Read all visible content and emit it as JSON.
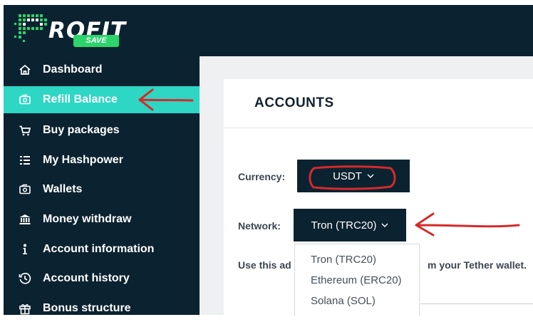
{
  "brand": {
    "logo_text": "ROFIT",
    "badge_text": "SAVE"
  },
  "sidebar": {
    "items": [
      {
        "label": "Dashboard",
        "icon": "home-icon",
        "active": false
      },
      {
        "label": "Refill Balance",
        "icon": "wallet-icon",
        "active": true
      },
      {
        "label": "Buy packages",
        "icon": "cart-icon",
        "active": false
      },
      {
        "label": "My Hashpower",
        "icon": "list-icon",
        "active": false
      },
      {
        "label": "Wallets",
        "icon": "wallet-icon",
        "active": false
      },
      {
        "label": "Money withdraw",
        "icon": "bank-icon",
        "active": false
      },
      {
        "label": "Account information",
        "icon": "info-icon",
        "active": false
      },
      {
        "label": "Account history",
        "icon": "history-icon",
        "active": false
      },
      {
        "label": "Bonus structure",
        "icon": "gift-icon",
        "active": false
      }
    ]
  },
  "main": {
    "title": "ACCOUNTS",
    "currency": {
      "label": "Currency:",
      "value": "USDT"
    },
    "network": {
      "label": "Network:",
      "value": "Tron (TRC20)",
      "options": [
        "Tron (TRC20)",
        "Ethereum (ERC20)",
        "Solana (SOL)"
      ]
    },
    "description_left": "Use this ad",
    "description_right": "m your Tether wallet."
  },
  "colors": {
    "sidebar_bg": "#0b2230",
    "active_item": "#2ed6c4",
    "annotation_red": "#d42a2a",
    "logo_badge": "#2bd46c"
  }
}
